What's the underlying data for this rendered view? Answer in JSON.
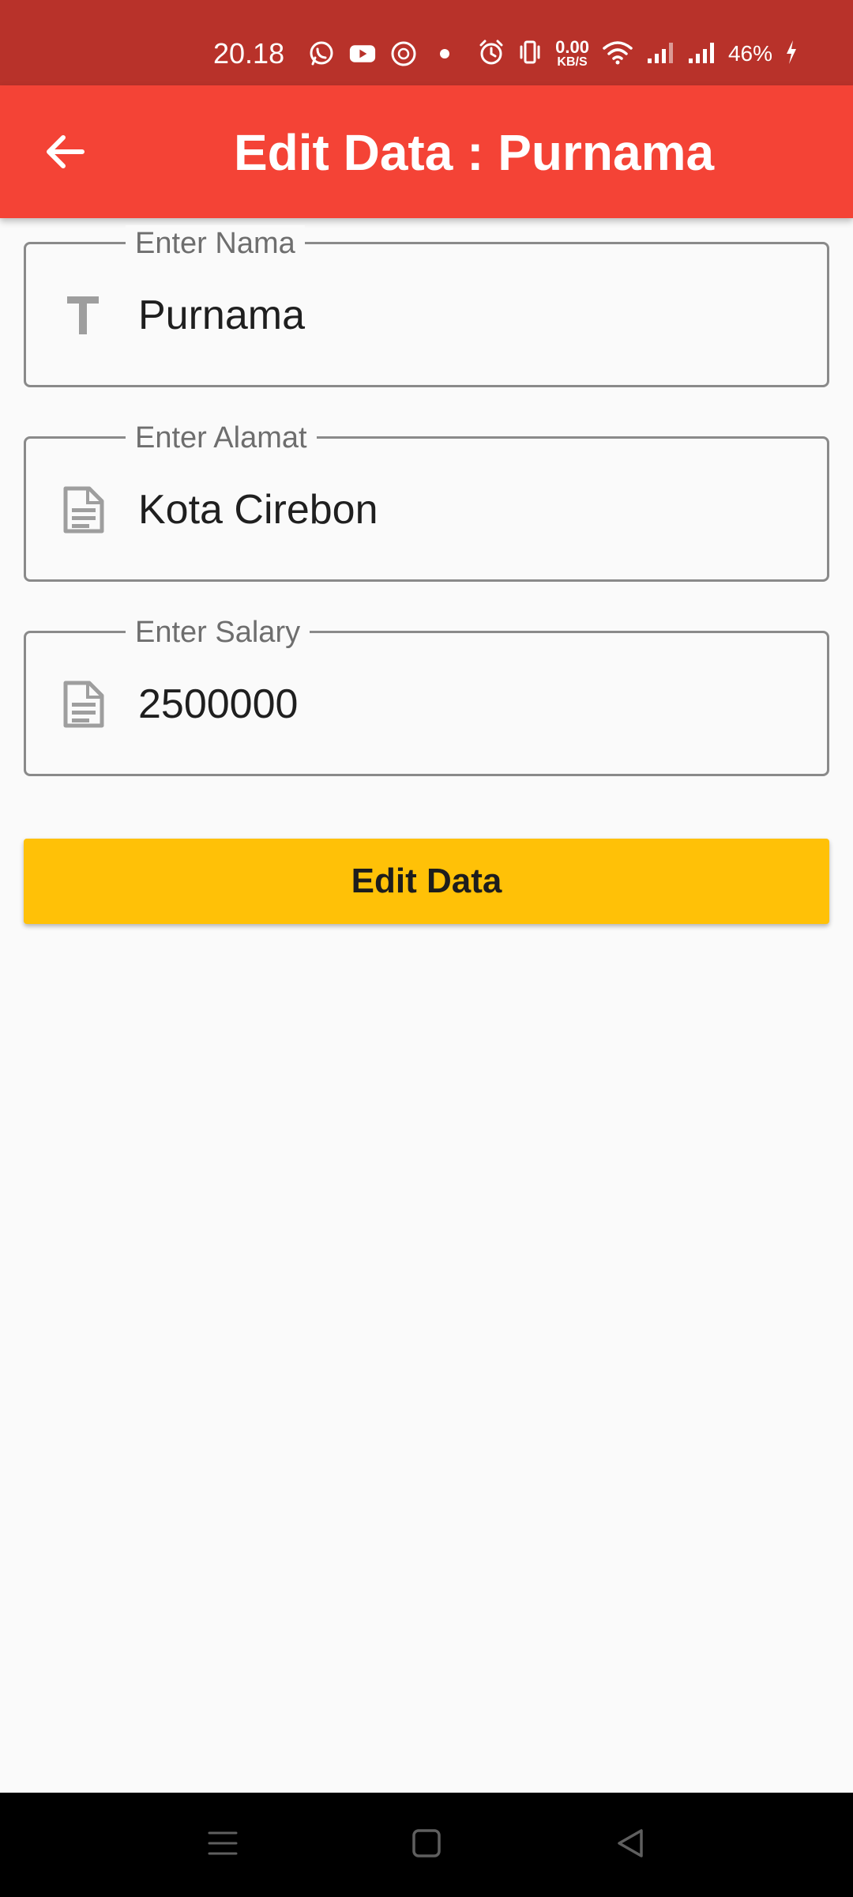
{
  "status_bar": {
    "time": "20.18",
    "icons": [
      "whatsapp-icon",
      "youtube-icon",
      "notification-badge-icon",
      "dot-icon"
    ],
    "network_speed_value": "0.00",
    "network_speed_unit": "KB/S",
    "battery": "46%",
    "colors": {
      "background": "#b8322a"
    }
  },
  "app_bar": {
    "title": "Edit Data : Purnama",
    "back_icon": "arrow-back-icon",
    "color": "#f44336"
  },
  "form": {
    "nama": {
      "label": "Enter Nama",
      "value": "Purnama",
      "icon": "text-fields-icon"
    },
    "alamat": {
      "label": "Enter Alamat",
      "value": "Kota Cirebon",
      "icon": "document-icon"
    },
    "salary": {
      "label": "Enter Salary",
      "value": "2500000",
      "icon": "document-icon"
    }
  },
  "button": {
    "label": "Edit Data",
    "color": "#ffc107"
  },
  "nav_bar": {
    "icons": [
      "menu-icon",
      "home-square-icon",
      "back-triangle-icon"
    ]
  }
}
